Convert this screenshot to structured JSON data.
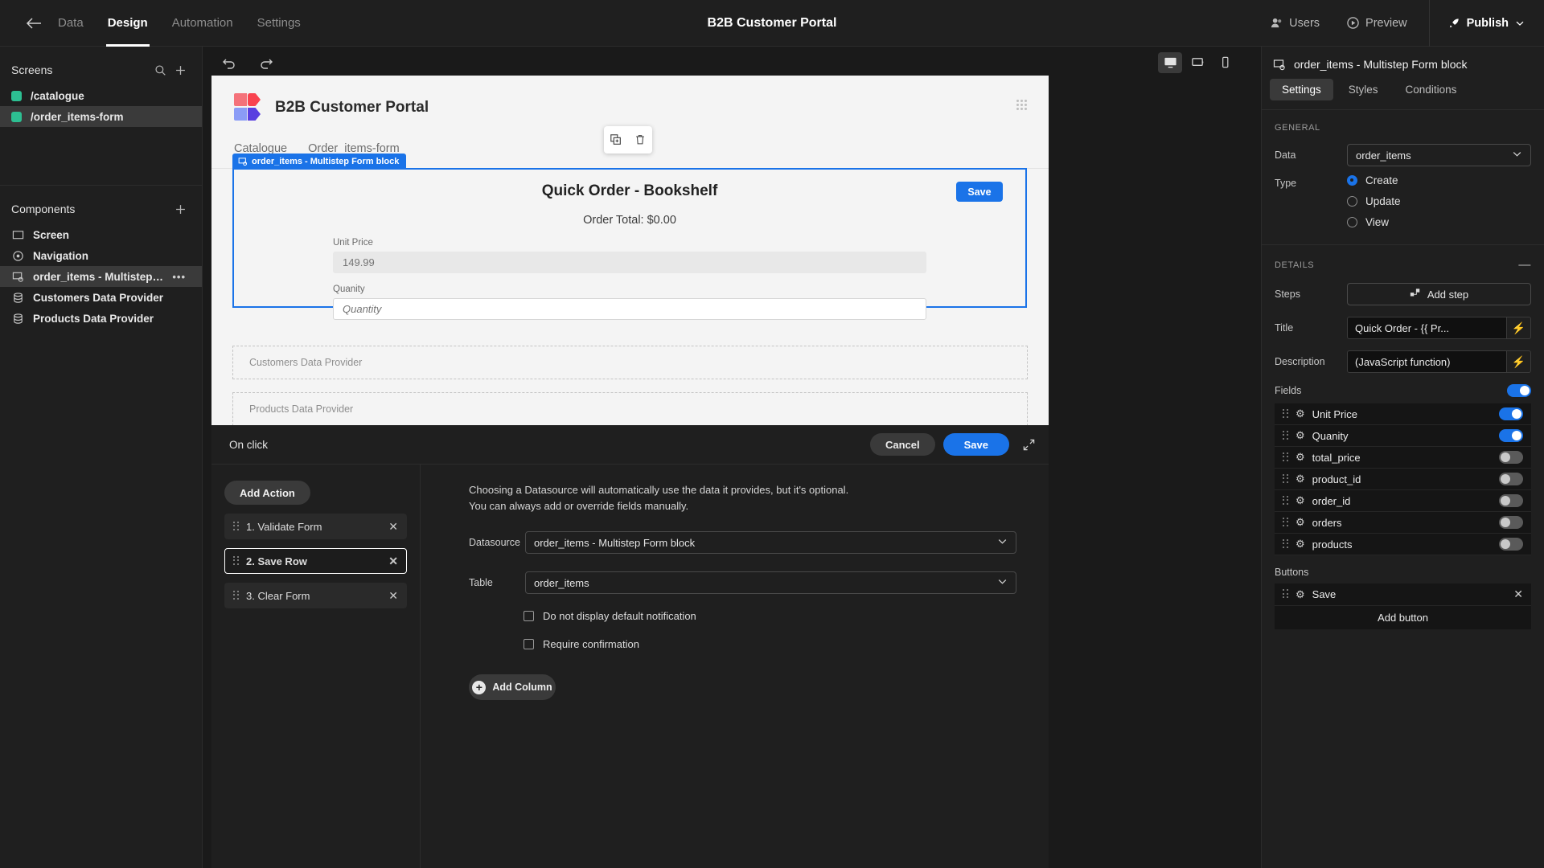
{
  "topbar": {
    "back_icon": "arrow-left-icon",
    "tabs": [
      {
        "label": "Data",
        "active": false
      },
      {
        "label": "Design",
        "active": true
      },
      {
        "label": "Automation",
        "active": false
      },
      {
        "label": "Settings",
        "active": false
      }
    ],
    "title": "B2B Customer Portal",
    "users_label": "Users",
    "preview_label": "Preview",
    "publish_label": "Publish"
  },
  "sidebar": {
    "screens_title": "Screens",
    "screens": [
      {
        "label": "/catalogue",
        "selected": false,
        "color": "#2dbf92"
      },
      {
        "label": "/order_items-form",
        "selected": true,
        "color": "#2dbf92"
      }
    ],
    "components_title": "Components",
    "components": [
      {
        "label": "Screen",
        "icon": "screen-icon",
        "selected": false
      },
      {
        "label": "Navigation",
        "icon": "navigation-icon",
        "selected": false
      },
      {
        "label": "order_items - Multistep For...",
        "icon": "form-block-icon",
        "selected": true,
        "more": "•••"
      },
      {
        "label": "Customers Data Provider",
        "icon": "database-icon",
        "selected": false
      },
      {
        "label": "Products Data Provider",
        "icon": "database-icon",
        "selected": false
      }
    ]
  },
  "canvas": {
    "undo_icon": "undo-icon",
    "redo_icon": "redo-icon",
    "devices": [
      {
        "name": "desktop-view",
        "active": true
      },
      {
        "name": "tablet-view",
        "active": false
      },
      {
        "name": "mobile-view",
        "active": false
      }
    ],
    "page": {
      "brand": "B2B Customer Portal",
      "nav": [
        "Catalogue",
        "Order_items-form"
      ],
      "block_tag": "order_items - Multistep Form block",
      "form": {
        "title": "Quick Order - Bookshelf",
        "order_total": "Order Total: $0.00",
        "save_label": "Save",
        "fields": [
          {
            "label": "Unit Price",
            "placeholder": "149.99",
            "style": "filled"
          },
          {
            "label": "Quanity",
            "placeholder": "Quantity",
            "style": "white"
          }
        ]
      },
      "placeholders": [
        "Customers Data Provider",
        "Products Data Provider"
      ]
    }
  },
  "drawer": {
    "title": "On click",
    "cancel_label": "Cancel",
    "save_label": "Save",
    "add_action_label": "Add Action",
    "actions": [
      {
        "label": "1. Validate Form",
        "selected": false
      },
      {
        "label": "2. Save Row",
        "selected": true
      },
      {
        "label": "3. Clear Form",
        "selected": false
      }
    ],
    "hint_line1": "Choosing a Datasource will automatically use the data it provides, but it's optional.",
    "hint_line2": "You can always add or override fields manually.",
    "datasource_label": "Datasource",
    "datasource_value": "order_items - Multistep Form block",
    "table_label": "Table",
    "table_value": "order_items",
    "checkboxes": [
      {
        "label": "Do not display default notification",
        "checked": false
      },
      {
        "label": "Require confirmation",
        "checked": false
      }
    ],
    "add_column_label": "Add Column"
  },
  "rpanel": {
    "component_name": "order_items - Multistep Form block",
    "tabs": [
      {
        "label": "Settings",
        "active": true
      },
      {
        "label": "Styles",
        "active": false
      },
      {
        "label": "Conditions",
        "active": false
      }
    ],
    "general_title": "GENERAL",
    "data_label": "Data",
    "data_value": "order_items",
    "type_label": "Type",
    "type_options": [
      {
        "label": "Create",
        "selected": true
      },
      {
        "label": "Update",
        "selected": false
      },
      {
        "label": "View",
        "selected": false
      }
    ],
    "details_title": "DETAILS",
    "steps_label": "Steps",
    "add_step_label": "Add step",
    "title_label": "Title",
    "title_value": "Quick Order - {{ Pr...",
    "description_label": "Description",
    "description_value": "(JavaScript function)",
    "fields_label": "Fields",
    "fields_enabled": true,
    "fields": [
      {
        "label": "Unit Price",
        "enabled": true
      },
      {
        "label": "Quanity",
        "enabled": true
      },
      {
        "label": "total_price",
        "enabled": false
      },
      {
        "label": "product_id",
        "enabled": false
      },
      {
        "label": "order_id",
        "enabled": false
      },
      {
        "label": "orders",
        "enabled": false
      },
      {
        "label": "products",
        "enabled": false
      }
    ],
    "buttons_label": "Buttons",
    "buttons": [
      {
        "label": "Save"
      }
    ],
    "add_button_label": "Add button"
  },
  "colors": {
    "accent": "#1a73e8",
    "screen_dot": "#2dbf92",
    "panel_bg": "#1f1f1f",
    "canvas_bg": "#f4f4f4"
  }
}
